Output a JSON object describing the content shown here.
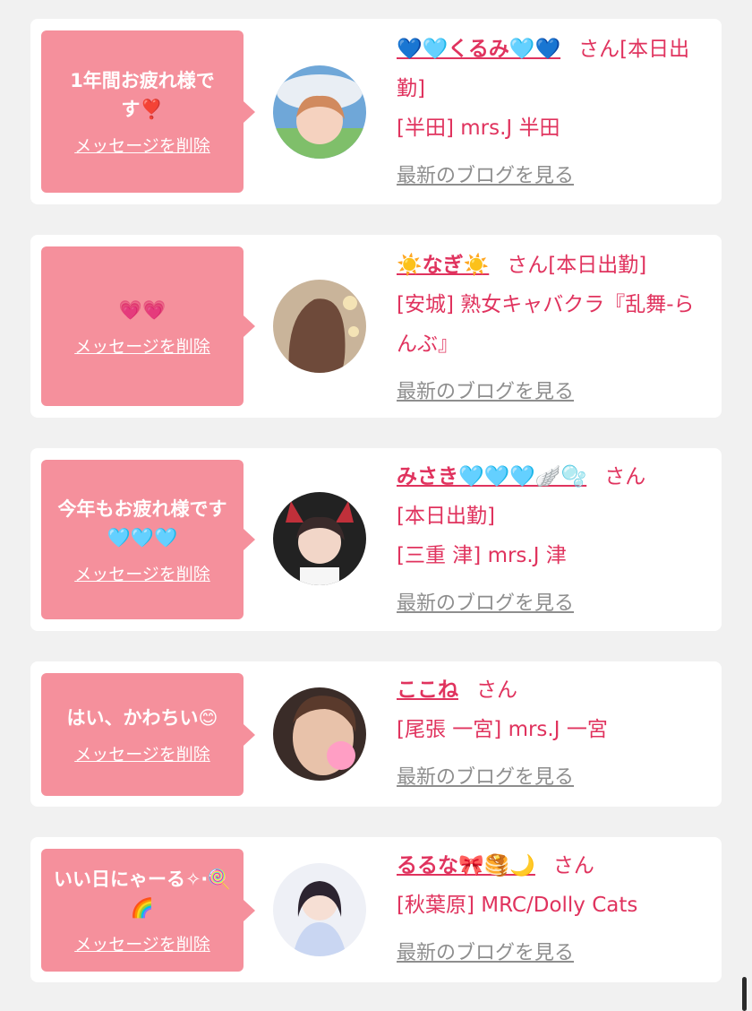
{
  "messages": [
    {
      "message": "1年間お疲れ様です❣️",
      "delete_label": "メッセージを削除",
      "name": "💙🩵くるみ🩵💙",
      "honorific": "さん",
      "status": "[本日出勤]",
      "shop": "[半田] mrs.J 半田",
      "blog_link": "最新のブログを見る"
    },
    {
      "message": "💗💗",
      "delete_label": "メッセージを削除",
      "name": "☀️なぎ☀️",
      "honorific": "さん",
      "status": "[本日出勤]",
      "shop": "[安城] 熟女キャバクラ『乱舞-らんぶ』",
      "blog_link": "最新のブログを見る"
    },
    {
      "message": "今年もお疲れ様です🩵🩵🩵",
      "delete_label": "メッセージを削除",
      "name": "みさき🩵🩵🩵🪽🫧",
      "honorific": "さん",
      "status": "[本日出勤]",
      "shop": "[三重 津] mrs.J 津",
      "blog_link": "最新のブログを見る"
    },
    {
      "message": "はい、かわちい😊",
      "delete_label": "メッセージを削除",
      "name": "ここね",
      "honorific": "さん",
      "status": "",
      "shop": "[尾張 一宮] mrs.J 一宮",
      "blog_link": "最新のブログを見る"
    },
    {
      "message": "いい日にゃーる✧︎‧🍭🌈",
      "delete_label": "メッセージを削除",
      "name": "るるな🎀🥞🌙",
      "honorific": "さん",
      "status": "",
      "shop": "[秋葉原] MRC/Dolly Cats",
      "blog_link": "最新のブログを見る"
    }
  ],
  "colors": {
    "accent": "#e0335e",
    "bubble": "#f5909c",
    "link_gray": "#8e8e8e",
    "background": "#f1f1f1"
  }
}
